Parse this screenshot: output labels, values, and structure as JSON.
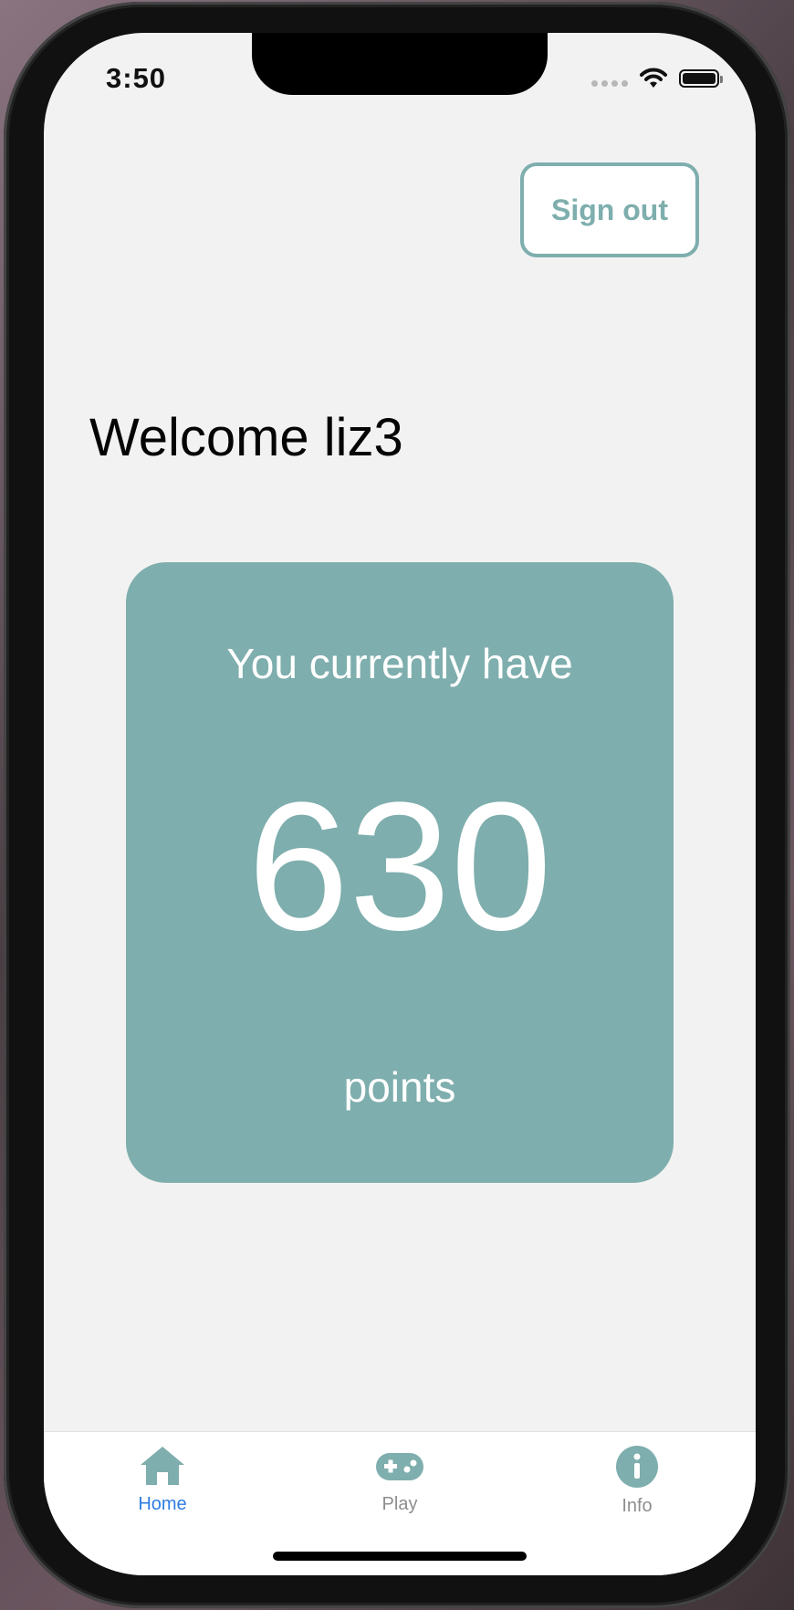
{
  "status_bar": {
    "time": "3:50"
  },
  "header": {
    "sign_out_label": "Sign out"
  },
  "main": {
    "welcome_text": "Welcome liz3",
    "points_card": {
      "label": "You currently have",
      "value": "630",
      "unit": "points"
    }
  },
  "tab_bar": {
    "items": [
      {
        "label": "Home",
        "icon": "home-icon",
        "active": true
      },
      {
        "label": "Play",
        "icon": "gamepad-icon",
        "active": false
      },
      {
        "label": "Info",
        "icon": "info-icon",
        "active": false
      }
    ]
  },
  "colors": {
    "accent": "#7eaead",
    "active_tab": "#2f7de1",
    "inactive_tab": "#8e8e8e",
    "background": "#f2f2f2"
  }
}
